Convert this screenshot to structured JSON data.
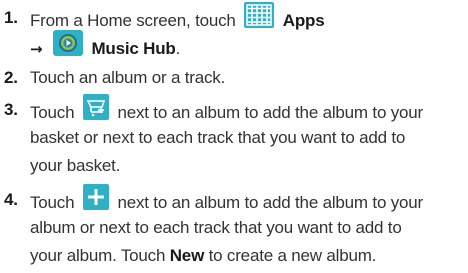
{
  "colors": {
    "icon_bg": "#2eb0c5",
    "text": "#333333",
    "accent_music": "#4caf50"
  },
  "steps": [
    {
      "number": "1.",
      "lines": [
        {
          "pre": "From a Home screen, touch",
          "icon": "apps-grid-icon",
          "bold": "Apps"
        },
        {
          "arrow": "→",
          "icon": "music-hub-icon",
          "bold": "Music Hub",
          "post": "."
        }
      ]
    },
    {
      "number": "2.",
      "lines": [
        {
          "text": "Touch an album or a track."
        }
      ]
    },
    {
      "number": "3.",
      "lines": [
        {
          "pre": "Touch",
          "icon": "basket-icon",
          "post": "next to an album to add the album to your"
        },
        {
          "text": "basket or next to each track that you want to add to"
        },
        {
          "text": "your basket."
        }
      ]
    },
    {
      "number": "4.",
      "lines": [
        {
          "pre": "Touch",
          "icon": "plus-icon",
          "post": "next to an album to add the album to your"
        },
        {
          "text": "album or next to each track that you want to add to"
        },
        {
          "pre": "your album. Touch",
          "bold": "New",
          "post": "to create a new album."
        }
      ]
    }
  ]
}
